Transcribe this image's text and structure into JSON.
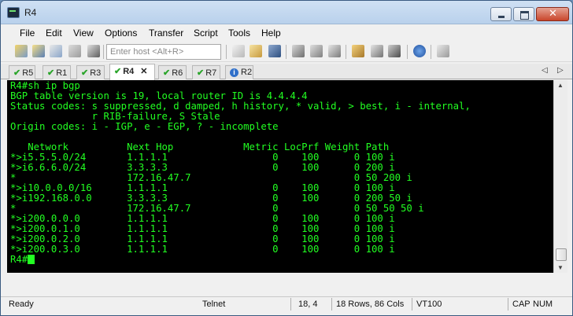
{
  "window": {
    "title": "R4"
  },
  "menu": [
    "File",
    "Edit",
    "View",
    "Options",
    "Transfer",
    "Script",
    "Tools",
    "Help"
  ],
  "toolbar": {
    "host_placeholder": "Enter host <Alt+R>",
    "icons": [
      "connect-icon",
      "quick-connect-icon",
      "reconnect-icon",
      "reconnect-all-icon",
      "disconnect-icon",
      "copy-icon",
      "paste-icon",
      "find-icon",
      "print-icon",
      "print-setup-icon",
      "print-screen-icon",
      "session-options-icon",
      "global-options-icon",
      "keymap-icon",
      "help-icon",
      "keyboard-icon"
    ]
  },
  "tabs": [
    {
      "label": "R5",
      "state": "connected",
      "active": false
    },
    {
      "label": "R1",
      "state": "connected",
      "active": false
    },
    {
      "label": "R3",
      "state": "connected",
      "active": false
    },
    {
      "label": "R4",
      "state": "connected",
      "active": true,
      "close": "✕"
    },
    {
      "label": "R6",
      "state": "connected",
      "active": false
    },
    {
      "label": "R7",
      "state": "connected",
      "active": false
    },
    {
      "label": "R2",
      "state": "info",
      "active": false
    }
  ],
  "tab_nav": {
    "prev": "◁",
    "next": "▷"
  },
  "terminal": {
    "lines": [
      "R4#sh ip bgp",
      "BGP table version is 19, local router ID is 4.4.4.4",
      "Status codes: s suppressed, d damped, h history, * valid, > best, i - internal,",
      "              r RIB-failure, S Stale",
      "Origin codes: i - IGP, e - EGP, ? - incomplete",
      "",
      "   Network          Next Hop            Metric LocPrf Weight Path",
      "*>i5.5.5.0/24       1.1.1.1                  0    100      0 100 i",
      "*>i6.6.6.0/24       3.3.3.3                  0    100      0 200 i",
      "*                   172.16.47.7                            0 50 200 i",
      "*>i10.0.0.0/16      1.1.1.1                  0    100      0 100 i",
      "*>i192.168.0.0      3.3.3.3                  0    100      0 200 50 i",
      "*                   172.16.47.7              0             0 50 50 50 i",
      "*>i200.0.0.0        1.1.1.1                  0    100      0 100 i",
      "*>i200.0.1.0        1.1.1.1                  0    100      0 100 i",
      "*>i200.0.2.0        1.1.1.1                  0    100      0 100 i",
      "*>i200.0.3.0        1.1.1.1                  0    100      0 100 i"
    ],
    "prompt": "R4#",
    "text_color": "#22ff22",
    "background": "#000000"
  },
  "status": {
    "state": "Ready",
    "protocol": "Telnet",
    "cursor_pos": "18,  4",
    "size": "18 Rows, 86 Cols",
    "emulation": "VT100",
    "caps": "CAP",
    "num": "NUM"
  }
}
